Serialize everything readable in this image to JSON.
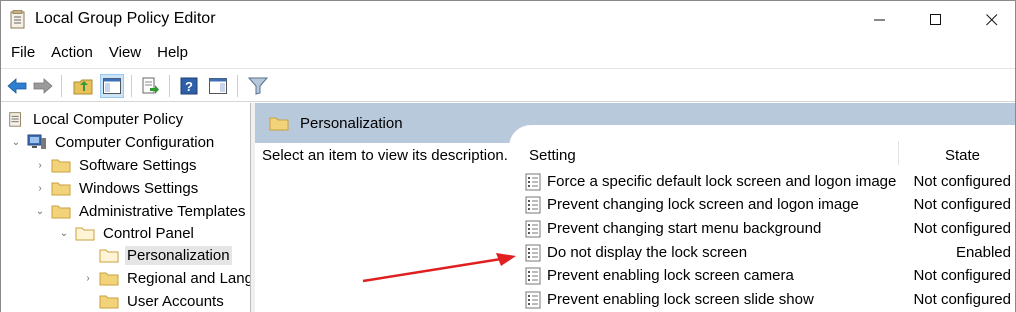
{
  "window": {
    "title": "Local Group Policy Editor"
  },
  "menu": [
    "File",
    "Action",
    "View",
    "Help"
  ],
  "tree": {
    "root": "Local Computer Policy",
    "computer_configuration": "Computer Configuration",
    "software_settings": "Software Settings",
    "windows_settings": "Windows Settings",
    "administrative_templates": "Administrative Templates",
    "control_panel": "Control Panel",
    "personalization": "Personalization",
    "regional": "Regional and Lang",
    "user_accounts": "User Accounts"
  },
  "pane": {
    "header_title": "Personalization",
    "description": "Select an item to view its description.",
    "columns": {
      "setting": "Setting",
      "state": "State"
    },
    "rows": [
      {
        "name": "Force a specific default lock screen and logon image",
        "state": "Not configured"
      },
      {
        "name": "Prevent changing lock screen and logon image",
        "state": "Not configured"
      },
      {
        "name": "Prevent changing start menu background",
        "state": "Not configured"
      },
      {
        "name": "Do not display the lock screen",
        "state": "Enabled"
      },
      {
        "name": "Prevent enabling lock screen camera",
        "state": "Not configured"
      },
      {
        "name": "Prevent enabling lock screen slide show",
        "state": "Not configured"
      }
    ]
  },
  "colors": {
    "header_band": "#b9c9dc",
    "selection": "#e5e5e5",
    "annotation_arrow": "#e02020"
  }
}
